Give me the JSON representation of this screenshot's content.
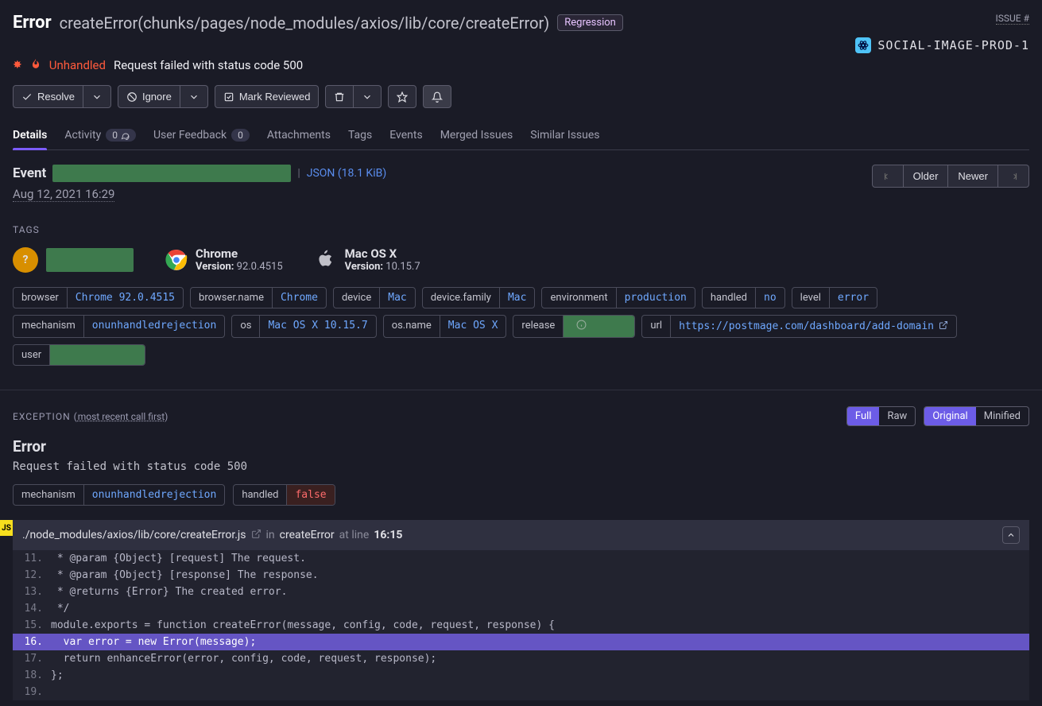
{
  "header": {
    "title": "Error",
    "subtitle": "createError(chunks/pages/node_modules/axios/lib/core/createError)",
    "badge": "Regression",
    "issue_label": "ISSUE #",
    "project_name": "SOCIAL-IMAGE-PROD-1",
    "unhandled_label": "Unhandled",
    "reason": "Request failed with status code 500"
  },
  "actions": {
    "resolve": "Resolve",
    "ignore": "Ignore",
    "mark_reviewed": "Mark Reviewed"
  },
  "tabs": {
    "details": "Details",
    "activity": "Activity",
    "activity_count": "0",
    "user_feedback": "User Feedback",
    "user_feedback_count": "0",
    "attachments": "Attachments",
    "tags": "Tags",
    "events": "Events",
    "merged": "Merged Issues",
    "similar": "Similar Issues"
  },
  "event": {
    "label": "Event",
    "json_link": "JSON (18.1 KiB)",
    "timestamp": "Aug 12, 2021 16:29",
    "pager": {
      "older": "Older",
      "newer": "Newer"
    }
  },
  "tags_section": {
    "heading": "TAGS",
    "avatar": "?",
    "browser_hl": {
      "name": "Chrome",
      "version_label": "Version:",
      "version": "92.0.4515"
    },
    "os_hl": {
      "name": "Mac OS X",
      "version_label": "Version:",
      "version": "10.15.7"
    },
    "pills": [
      {
        "k": "browser",
        "v": "Chrome 92.0.4515"
      },
      {
        "k": "browser.name",
        "v": "Chrome"
      },
      {
        "k": "device",
        "v": "Mac"
      },
      {
        "k": "device.family",
        "v": "Mac"
      },
      {
        "k": "environment",
        "v": "production"
      },
      {
        "k": "handled",
        "v": "no"
      },
      {
        "k": "level",
        "v": "error"
      },
      {
        "k": "mechanism",
        "v": "onunhandledrejection"
      },
      {
        "k": "os",
        "v": "Mac OS X 10.15.7"
      },
      {
        "k": "os.name",
        "v": "Mac OS X"
      },
      {
        "k": "release",
        "v": "",
        "redacted": true,
        "info": true
      },
      {
        "k": "url",
        "v": "https://postmage.com/dashboard/add-domain",
        "ext": true
      },
      {
        "k": "user",
        "v": "",
        "redacted": true,
        "wide": true
      }
    ]
  },
  "exception": {
    "title": "EXCEPTION",
    "call_order": "most recent call first",
    "full": "Full",
    "raw": "Raw",
    "original": "Original",
    "minified": "Minified",
    "error_heading": "Error",
    "error_msg": "Request failed with status code 500",
    "pill_mechanism_k": "mechanism",
    "pill_mechanism_v": "onunhandledrejection",
    "pill_handled_k": "handled",
    "pill_handled_v": "false"
  },
  "frame": {
    "path": "./node_modules/axios/lib/core/createError.js",
    "in": "in",
    "fn": "createError",
    "at_line": "at line",
    "line": "16:15",
    "js_badge": "JS",
    "code": [
      {
        "n": "11.",
        "t": " * @param {Object} [request] The request."
      },
      {
        "n": "12.",
        "t": " * @param {Object} [response] The response."
      },
      {
        "n": "13.",
        "t": " * @returns {Error} The created error."
      },
      {
        "n": "14.",
        "t": " */"
      },
      {
        "n": "15.",
        "t": "module.exports = function createError(message, config, code, request, response) {"
      },
      {
        "n": "16.",
        "t": "  var error = new Error(message);",
        "hl": true
      },
      {
        "n": "17.",
        "t": "  return enhanceError(error, config, code, request, response);"
      },
      {
        "n": "18.",
        "t": "};"
      },
      {
        "n": "19.",
        "t": ""
      }
    ]
  }
}
